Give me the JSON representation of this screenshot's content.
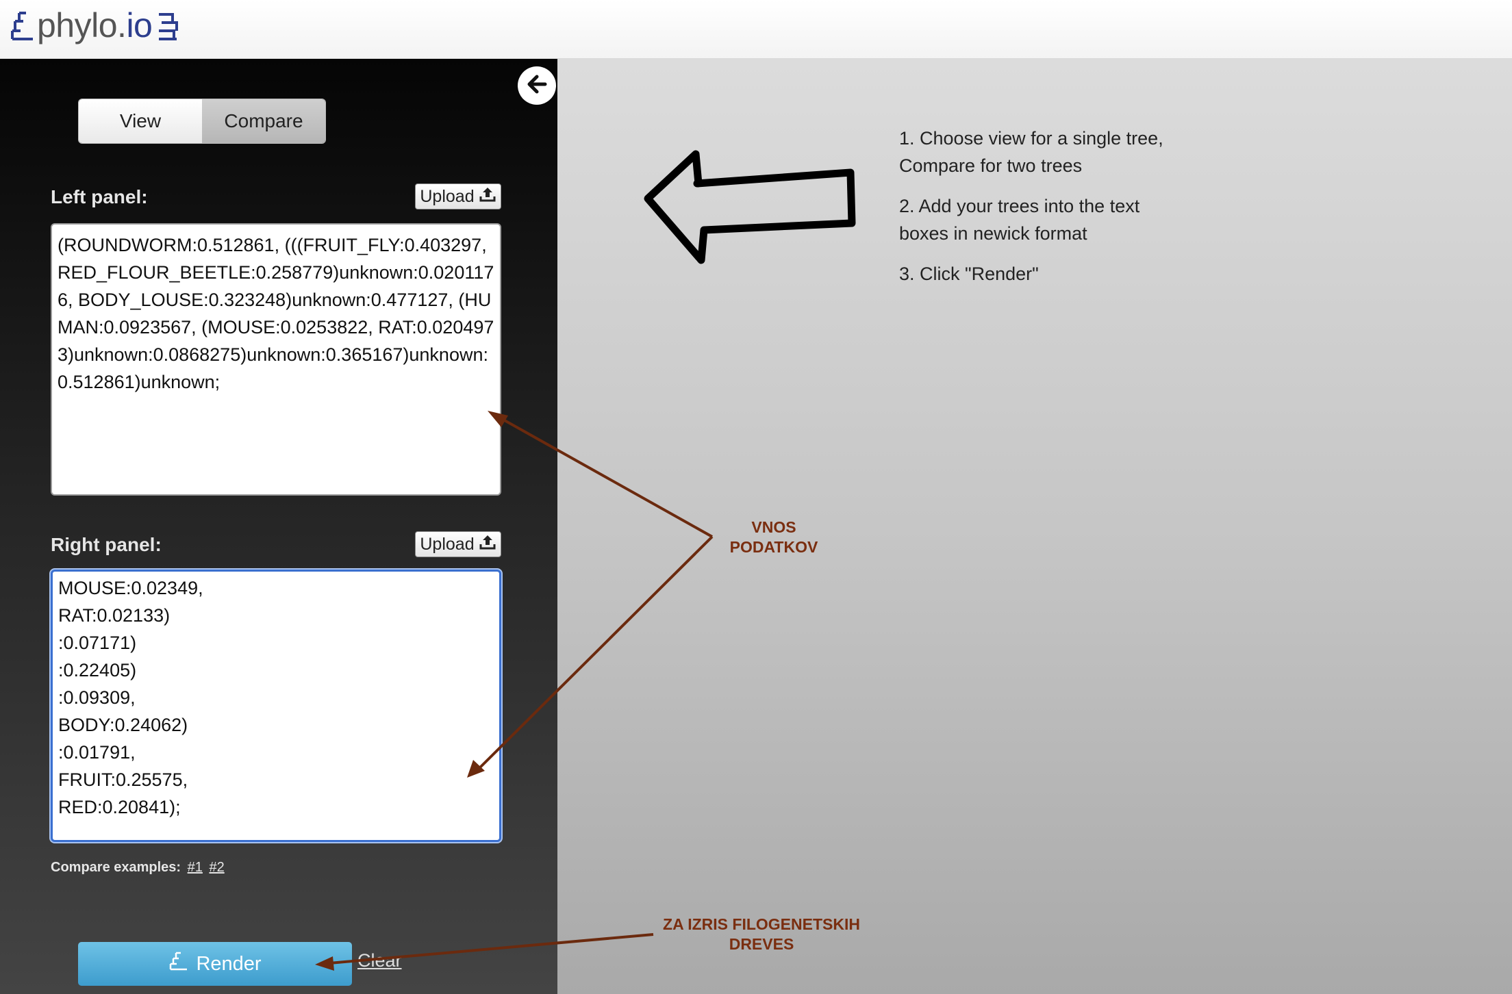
{
  "header": {
    "logo_text": "phylo",
    "logo_dot": ".",
    "logo_suffix": "io"
  },
  "sidebar": {
    "mode_tabs": [
      "View",
      "Compare"
    ],
    "selected_mode": "View",
    "left_panel": {
      "label": "Left panel:",
      "upload_label": "Upload",
      "tree_text": "(ROUNDWORM:0.512861, (((FRUIT_FLY:0.403297, RED_FLOUR_BEETLE:0.258779)unknown:0.0201176, BODY_LOUSE:0.323248)unknown:0.477127, (HUMAN:0.0923567, (MOUSE:0.0253822, RAT:0.0204973)unknown:0.0868275)unknown:0.365167)unknown:0.512861)unknown;"
    },
    "right_panel": {
      "label": "Right panel:",
      "upload_label": "Upload",
      "tree_text": "MOUSE:0.02349,\nRAT:0.02133)\n:0.07171)\n:0.22405)\n:0.09309,\nBODY:0.24062)\n:0.01791,\nFRUIT:0.25575,\nRED:0.20841);"
    },
    "examples": {
      "label": "Compare examples:",
      "links": [
        "#1",
        "#2"
      ]
    },
    "render_label": "Render",
    "clear_label": "Clear"
  },
  "instructions": [
    "1. Choose view for a single tree, Compare for two trees",
    "2. Add your trees into the text boxes in newick format",
    "3. Click \"Render\""
  ],
  "annotations": {
    "data_input": [
      "VNOS",
      "PODATKOV"
    ],
    "render_note": [
      "ZA IZRIS FILOGENETSKIH",
      "DREVES"
    ]
  },
  "colors": {
    "accent": "#2d3e8e",
    "annotation": "#7a2e10",
    "render_button": "#4fb0dc",
    "focus_border": "#3a6fcf"
  },
  "icons": [
    "phylo-logo-icon",
    "arrow-left-icon",
    "upload-icon",
    "tree-icon"
  ]
}
